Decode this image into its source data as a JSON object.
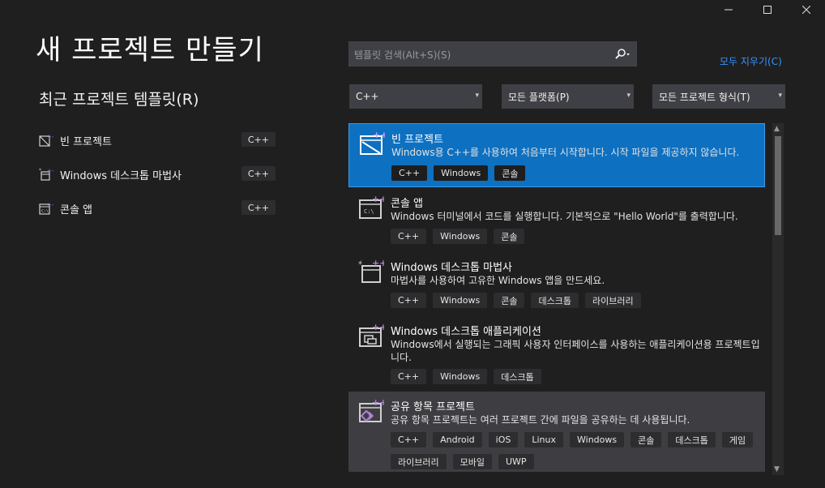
{
  "window": {
    "minimize_icon": "minimize-icon",
    "maximize_icon": "maximize-icon",
    "close_icon": "close-icon"
  },
  "page_title": "새 프로젝트 만들기",
  "recent": {
    "title": "최근 프로젝트 템플릿(R)",
    "items": [
      {
        "label": "빈 프로젝트",
        "badge": "C++",
        "icon": "empty-project-icon"
      },
      {
        "label": "Windows 데스크톱 마법사",
        "badge": "C++",
        "icon": "desktop-wizard-icon"
      },
      {
        "label": "콘솔 앱",
        "badge": "C++",
        "icon": "console-app-icon"
      }
    ]
  },
  "search": {
    "placeholder": "템플릿 검색(Alt+S)(S)",
    "icon": "search-icon"
  },
  "clear_all": "모두 지우기(C)",
  "filters": {
    "language": "C++",
    "platform": "모든 플랫폼(P)",
    "project_type": "모든 프로젝트 형식(T)"
  },
  "templates": [
    {
      "title": "빈 프로젝트",
      "description": "Windows용 C++를 사용하여 처음부터 시작합니다. 시작 파일을 제공하지 않습니다.",
      "tags": [
        "C++",
        "Windows",
        "콘솔"
      ],
      "icon": "empty-project-icon",
      "state": "selected"
    },
    {
      "title": "콘솔 앱",
      "description": "Windows 터미널에서 코드를 실행합니다. 기본적으로 \"Hello World\"를 출력합니다.",
      "tags": [
        "C++",
        "Windows",
        "콘솔"
      ],
      "icon": "console-app-icon",
      "state": "normal"
    },
    {
      "title": "Windows 데스크톱 마법사",
      "description": "마법사를 사용하여 고유한 Windows 앱을 만드세요.",
      "tags": [
        "C++",
        "Windows",
        "콘솔",
        "데스크톱",
        "라이브러리"
      ],
      "icon": "desktop-wizard-icon",
      "state": "normal"
    },
    {
      "title": "Windows 데스크톱 애플리케이션",
      "description": "Windows에서 실행되는 그래픽 사용자 인터페이스를 사용하는 애플리케이션용 프로젝트입니다.",
      "tags": [
        "C++",
        "Windows",
        "데스크톱"
      ],
      "icon": "desktop-application-icon",
      "state": "normal"
    },
    {
      "title": "공유 항목 프로젝트",
      "description": "공유 항목 프로젝트는 여러 프로젝트 간에 파일을 공유하는 데 사용됩니다.",
      "tags": [
        "C++",
        "Android",
        "iOS",
        "Linux",
        "Windows",
        "콘솔",
        "데스크톱",
        "게임",
        "라이브러리",
        "모바일",
        "UWP"
      ],
      "icon": "shared-items-icon",
      "state": "hover"
    }
  ],
  "colors": {
    "background": "#1f1f1f",
    "selected": "#0e70c0",
    "accent_link": "#3794ff",
    "cpp_badge": "#7b5fc4"
  }
}
